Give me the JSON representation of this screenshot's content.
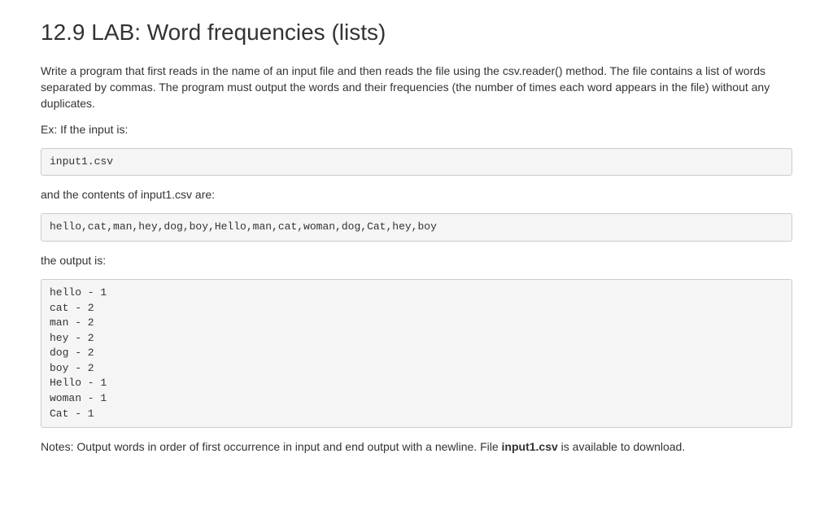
{
  "title": "12.9 LAB: Word frequencies (lists)",
  "paragraphs": {
    "intro": "Write a program that first reads in the name of an input file and then reads the file using the csv.reader() method. The file contains a list of words separated by commas. The program must output the words and their frequencies (the number of times each word appears in the file) without any duplicates.",
    "ex_if_input": "Ex: If the input is:",
    "and_contents": "and the contents of input1.csv are:",
    "output_is": "the output is:",
    "notes_prefix": "Notes: Output words in order of first occurrence in input and end output with a newline. File ",
    "notes_bold": "input1.csv",
    "notes_suffix": " is available to download."
  },
  "code": {
    "input_filename": "input1.csv",
    "csv_contents": "hello,cat,man,hey,dog,boy,Hello,man,cat,woman,dog,Cat,hey,boy",
    "output": "hello - 1\ncat - 2\nman - 2\nhey - 2\ndog - 2\nboy - 2\nHello - 1\nwoman - 1\nCat - 1"
  }
}
